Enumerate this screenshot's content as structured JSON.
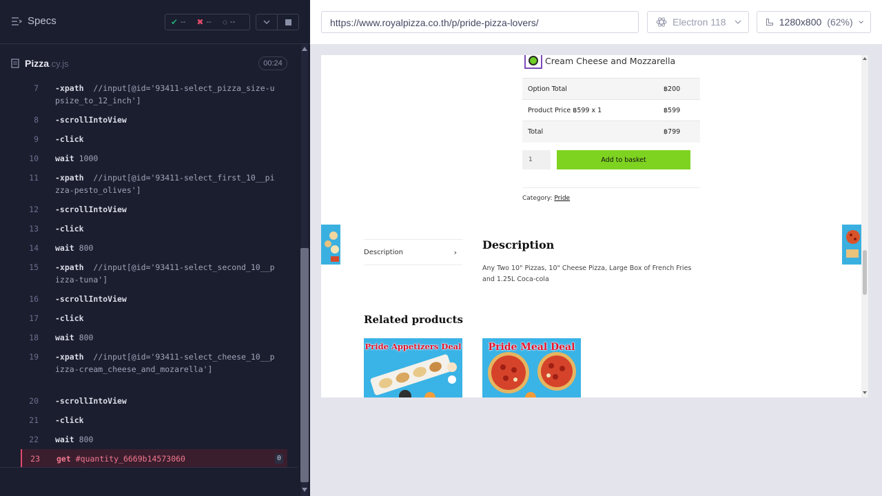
{
  "runner": {
    "specs_label": "Specs",
    "stats": {
      "passed": "--",
      "failed": "--",
      "pending": "--"
    },
    "spec": {
      "name": "Pizza",
      "ext": ".cy.js",
      "duration": "00:24"
    },
    "commands": [
      {
        "num": "7",
        "name": "-xpath",
        "msg": "//input[@id='93411-select_pizza_size-upsize_to_12_inch']"
      },
      {
        "num": "8",
        "name": "-scrollIntoView",
        "msg": ""
      },
      {
        "num": "9",
        "name": "-click",
        "msg": ""
      },
      {
        "num": "10",
        "name": "wait",
        "msg": "1000"
      },
      {
        "num": "11",
        "name": "-xpath",
        "msg": "//input[@id='93411-select_first_10__pizza-pesto_olives']"
      },
      {
        "num": "12",
        "name": "-scrollIntoView",
        "msg": ""
      },
      {
        "num": "13",
        "name": "-click",
        "msg": ""
      },
      {
        "num": "14",
        "name": "wait",
        "msg": "800"
      },
      {
        "num": "15",
        "name": "-xpath",
        "msg": "//input[@id='93411-select_second_10__pizza-tuna']"
      },
      {
        "num": "16",
        "name": "-scrollIntoView",
        "msg": ""
      },
      {
        "num": "17",
        "name": "-click",
        "msg": ""
      },
      {
        "num": "18",
        "name": "wait",
        "msg": "800"
      },
      {
        "num": "19",
        "name": "-xpath",
        "msg": "//input[@id='93411-select_cheese_10__pizza-cream_cheese_and_mozarella']"
      },
      {
        "num": "20",
        "name": "-scrollIntoView",
        "msg": ""
      },
      {
        "num": "21",
        "name": "-click",
        "msg": ""
      },
      {
        "num": "22",
        "name": "wait",
        "msg": "800"
      },
      {
        "num": "23",
        "name": "get",
        "msg": "#quantity_6669b14573060",
        "badge": "0"
      }
    ]
  },
  "browser": {
    "url": "https://www.royalpizza.co.th/p/pride-pizza-lovers/",
    "engine": "Electron 118",
    "viewport": "1280x800",
    "zoom": "(62%)"
  },
  "page": {
    "radio_label": "Cream Cheese and Mozzarella",
    "price_rows": [
      {
        "label": "Option Total",
        "value": "฿200"
      },
      {
        "label": "Product Price ฿599 x 1",
        "value": "฿599"
      },
      {
        "label": "Total",
        "value": "฿799"
      }
    ],
    "quantity": "1",
    "add_to_basket": "Add to basket",
    "category_label": "Category:",
    "category_link": "Pride",
    "tab_description": "Description",
    "description_title": "Description",
    "description_text": "Any Two 10\" Pizzas, 10\" Cheese Pizza, Large Box of French Fries and 1.25L Coca-cola",
    "related_title": "Related products",
    "products": [
      {
        "name": "Pride Appetizers Deal"
      },
      {
        "name": "Pride Meal Deal"
      }
    ]
  },
  "colors": {
    "runner_bg": "#1b1e2e",
    "active_cmd": "#f2778f",
    "basket_button": "#7ed321",
    "product_bg": "#3ab3e6"
  }
}
